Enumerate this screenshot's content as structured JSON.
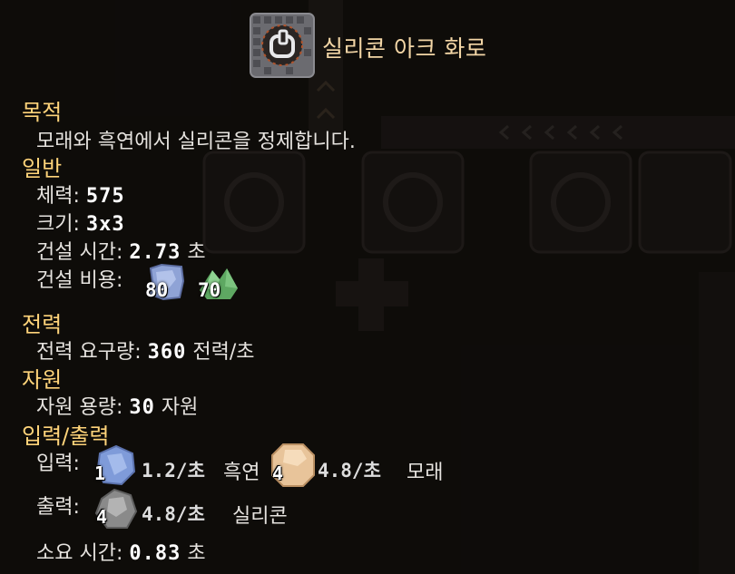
{
  "building": {
    "name": "실리콘 아크 화로",
    "icon": "silicon-arc-furnace-icon"
  },
  "sections": {
    "purpose_header": "목적",
    "purpose_text": "모래와 흑연에서 실리콘을 정제합니다.",
    "general_header": "일반",
    "power_header": "전력",
    "resource_header": "자원",
    "io_header": "입력/출력"
  },
  "general": {
    "health_label": "체력:",
    "health_value": "575",
    "size_label": "크기:",
    "size_value": "3x3",
    "build_time_label": "건설 시간:",
    "build_time_value": "2.73",
    "build_time_unit": "초",
    "build_cost_label": "건설 비용:",
    "costs": [
      {
        "icon": "copper-icon",
        "amount": "80"
      },
      {
        "icon": "lead-icon",
        "amount": "70"
      }
    ]
  },
  "power": {
    "label": "전력 요구량:",
    "value": "360",
    "unit": "전력/초"
  },
  "resource": {
    "label": "자원 용량:",
    "value": "30",
    "unit": "자원"
  },
  "io": {
    "input_label": "입력:",
    "inputs": [
      {
        "icon": "graphite-icon",
        "count": "1",
        "rate": "1.2/초",
        "name": "흑연"
      },
      {
        "icon": "sand-icon",
        "count": "4",
        "rate": "4.8/초",
        "name": "모래"
      }
    ],
    "output_label": "출력:",
    "outputs": [
      {
        "icon": "silicon-icon",
        "count": "4",
        "rate": "4.8/초",
        "name": "실리콘"
      }
    ],
    "craft_time_label": "소요 시간:",
    "craft_time_value": "0.83",
    "craft_time_unit": "초"
  },
  "colors": {
    "section_header": "#ffd47a",
    "title": "#f3d6a6",
    "body_text": "#e6e3df",
    "copper": "#8fa3d6",
    "lead": "#6fbf73",
    "graphite": "#7f9bd9",
    "sand": "#e8c49a",
    "silicon": "#8a8a8a"
  }
}
